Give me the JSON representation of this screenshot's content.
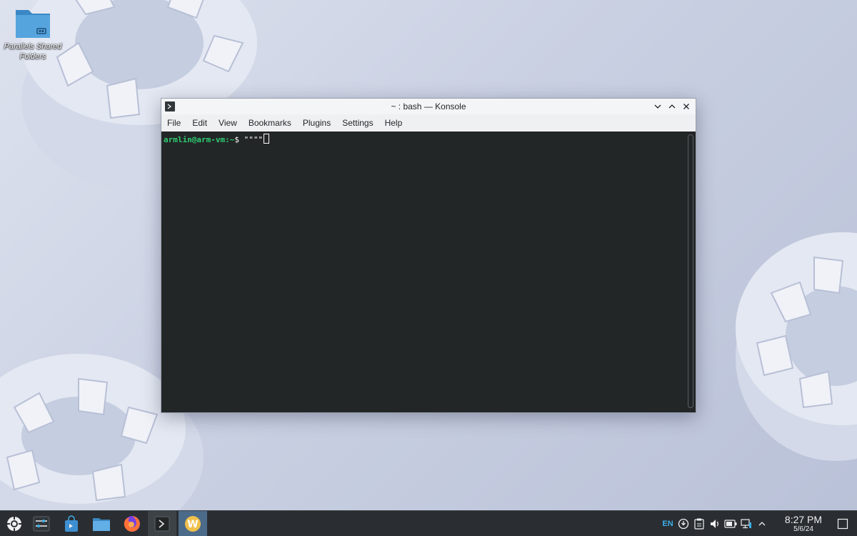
{
  "desktop": {
    "icons": [
      {
        "label": "Parallels Shared Folders",
        "icon": "folder-shared-icon"
      }
    ]
  },
  "window": {
    "title": "~ : bash — Konsole",
    "menu": [
      "File",
      "Edit",
      "View",
      "Bookmarks",
      "Plugins",
      "Settings",
      "Help"
    ],
    "terminal": {
      "prompt_user": "armlin@arm-vm:~",
      "prompt_symbol": "$ ",
      "command": "\"\"\"\""
    }
  },
  "taskbar": {
    "apps": [
      {
        "name": "application-launcher",
        "icon": "kde-launcher-icon"
      },
      {
        "name": "system-settings",
        "icon": "settings-sliders-icon"
      },
      {
        "name": "discover",
        "icon": "store-bag-icon"
      },
      {
        "name": "dolphin",
        "icon": "folder-icon"
      },
      {
        "name": "firefox",
        "icon": "firefox-icon"
      },
      {
        "name": "konsole",
        "icon": "terminal-icon"
      },
      {
        "name": "w-app",
        "icon": "w-app-icon"
      }
    ],
    "tray": {
      "language": "EN",
      "clock_time": "8:27 PM",
      "clock_date": "5/6/24"
    }
  },
  "colors": {
    "terminal_bg": "#232627",
    "prompt_green": "#2ecc71",
    "taskbar_bg": "#2a2e32",
    "accent": "#3daee9"
  }
}
